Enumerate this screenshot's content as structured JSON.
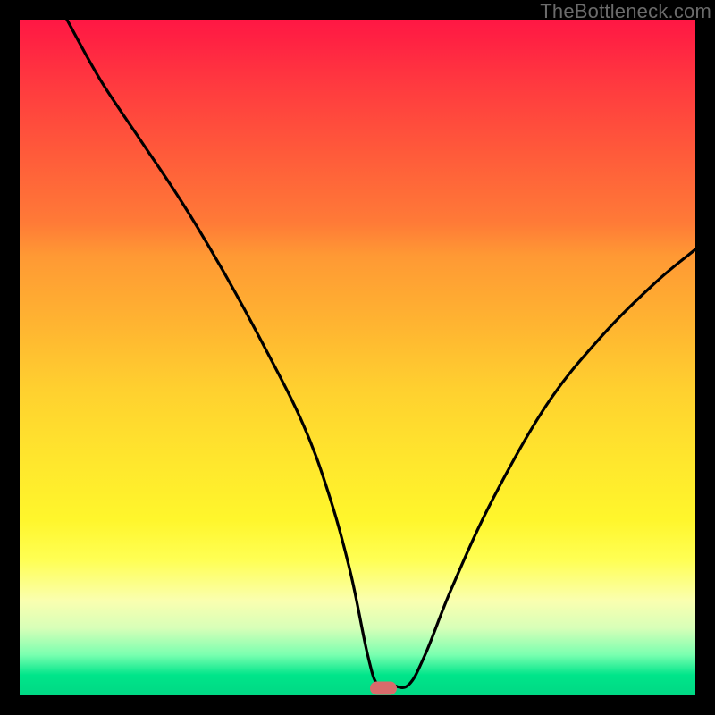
{
  "watermark": {
    "text": "TheBottleneck.com"
  },
  "marker": {
    "x_pct": 53.8,
    "y_pct": 99.0
  },
  "chart_data": {
    "type": "line",
    "title": "",
    "xlabel": "",
    "ylabel": "",
    "xlim": [
      0,
      100
    ],
    "ylim": [
      0,
      100
    ],
    "grid": false,
    "legend": false,
    "series": [
      {
        "name": "bottleneck-curve",
        "x": [
          7,
          12,
          18,
          24,
          30,
          36,
          42,
          46,
          49,
          51.5,
          53,
          55,
          57.5,
          60,
          64,
          70,
          78,
          86,
          94,
          100
        ],
        "y": [
          100,
          91,
          82,
          73,
          63,
          52,
          40,
          29,
          18,
          6,
          1.5,
          1.5,
          1.5,
          6,
          16,
          29,
          43,
          53,
          61,
          66
        ]
      }
    ],
    "annotations": [
      {
        "type": "marker",
        "shape": "pill",
        "color": "#d96b6b",
        "x": 53.8,
        "y": 1.0
      }
    ],
    "background_gradient": {
      "direction": "top-to-bottom",
      "stops": [
        {
          "pos": 0.0,
          "color": "#ff1744"
        },
        {
          "pos": 0.3,
          "color": "#ff7a37"
        },
        {
          "pos": 0.55,
          "color": "#ffd12f"
        },
        {
          "pos": 0.8,
          "color": "#ffff54"
        },
        {
          "pos": 0.94,
          "color": "#7affb0"
        },
        {
          "pos": 1.0,
          "color": "#00d884"
        }
      ]
    }
  }
}
